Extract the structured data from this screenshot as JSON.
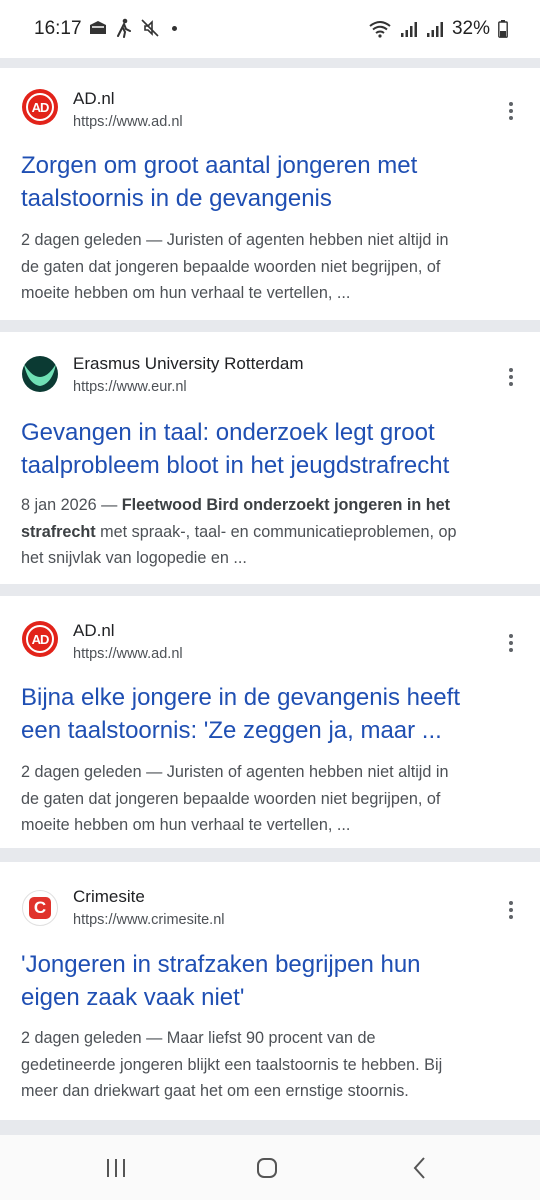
{
  "status_bar": {
    "time": "16:17",
    "battery": "32%",
    "left_icons": [
      "notification-icon",
      "walking-icon",
      "no-sound-icon",
      "dot-icon"
    ],
    "right_icons": [
      "wifi-icon",
      "signal-icon",
      "signal-icon",
      "battery-icon"
    ]
  },
  "results": [
    {
      "site": "AD.nl",
      "url": "https://www.ad.nl",
      "logo": "ad-logo-icon",
      "logo_text": "AD",
      "title_lines": [
        "Zorgen om groot aantal jongeren met",
        "taalstoornis in de gevangenis"
      ],
      "snippet_lines": [
        "2 dagen geleden — Juristen of agenten hebben niet altijd in",
        "de gaten dat jongeren bepaalde woorden niet begrijpen, of",
        "moeite hebben om hun verhaal te vertellen, ..."
      ]
    },
    {
      "site": "Erasmus University Rotterdam",
      "url": "https://www.eur.nl",
      "logo": "eur-logo-icon",
      "title_lines": [
        "Gevangen in taal: onderzoek legt groot",
        "taalprobleem bloot in het jeugdstrafrecht"
      ],
      "snippet_date": "8 jan 2026 — ",
      "snippet_bold_1": "Fleetwood Bird onderzoekt jongeren in het",
      "snippet_bold_2": "strafrecht",
      "snippet_rest_2": " met spraak-, taal- en communicatieproblemen, op",
      "snippet_line_3": "het snijvlak van logopedie en ..."
    },
    {
      "site": "AD.nl",
      "url": "https://www.ad.nl",
      "logo": "ad-logo-icon",
      "logo_text": "AD",
      "title_lines": [
        "Bijna elke jongere in de gevangenis heeft",
        "een taalstoornis: 'Ze zeggen ja, maar ..."
      ],
      "snippet_lines": [
        "2 dagen geleden — Juristen of agenten hebben niet altijd in",
        "de gaten dat jongeren bepaalde woorden niet begrijpen, of",
        "moeite hebben om hun verhaal te vertellen, ..."
      ]
    },
    {
      "site": "Crimesite",
      "url": "https://www.crimesite.nl",
      "logo": "crimesite-logo-icon",
      "logo_text": "C",
      "title_lines": [
        "'Jongeren in strafzaken begrijpen hun",
        "eigen zaak vaak niet'"
      ],
      "snippet_lines": [
        "2 dagen geleden — Maar liefst 90 procent van de",
        "gedetineerde jongeren blijkt een taalstoornis te hebben. Bij",
        "meer dan driekwart gaat het om een ernstige stoornis."
      ]
    }
  ],
  "nav_bar": {
    "buttons": [
      "recents-icon",
      "home-icon",
      "back-icon"
    ]
  }
}
